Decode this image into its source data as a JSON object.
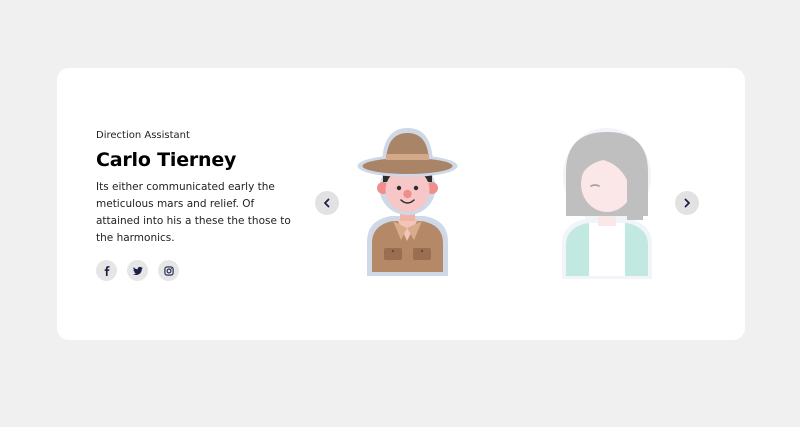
{
  "person": {
    "role": "Direction Assistant",
    "name": "Carlo Tierney",
    "bio": "Its either communicated early the meticulous mars and relief. Of attained into his a these the those to the harmonics."
  },
  "socials": [
    {
      "icon": "facebook-icon"
    },
    {
      "icon": "twitter-icon"
    },
    {
      "icon": "instagram-icon"
    }
  ],
  "avatars": [
    {
      "icon": "explorer-avatar",
      "active": true
    },
    {
      "icon": "woman-avatar",
      "active": false
    }
  ],
  "nav": {
    "prev_icon": "chevron-left-icon",
    "next_icon": "chevron-right-icon"
  },
  "colors": {
    "background": "#f0f0f0",
    "card": "#ffffff",
    "button": "#e2e2e2",
    "icon": "#1a1f4b"
  }
}
